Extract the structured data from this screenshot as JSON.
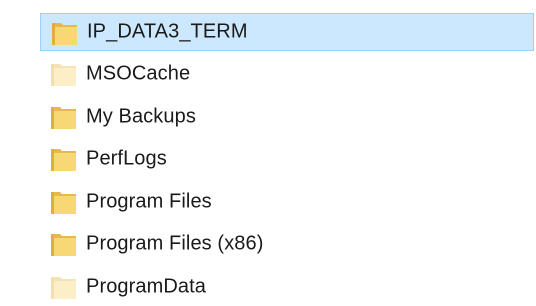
{
  "file_list": {
    "selected_index": 0,
    "items": [
      {
        "label": "IP_DATA3_TERM",
        "icon": "folder-icon",
        "hidden": false
      },
      {
        "label": "MSOCache",
        "icon": "folder-icon",
        "hidden": true
      },
      {
        "label": "My Backups",
        "icon": "folder-icon",
        "hidden": false
      },
      {
        "label": "PerfLogs",
        "icon": "folder-icon",
        "hidden": false
      },
      {
        "label": "Program Files",
        "icon": "folder-icon",
        "hidden": false
      },
      {
        "label": "Program Files (x86)",
        "icon": "folder-icon",
        "hidden": false
      },
      {
        "label": "ProgramData",
        "icon": "folder-icon",
        "hidden": true
      }
    ]
  },
  "colors": {
    "folder_front": "#f8d775",
    "folder_back": "#e8b84a",
    "selection_bg": "#cce8ff",
    "selection_border": "#99d1ff"
  }
}
